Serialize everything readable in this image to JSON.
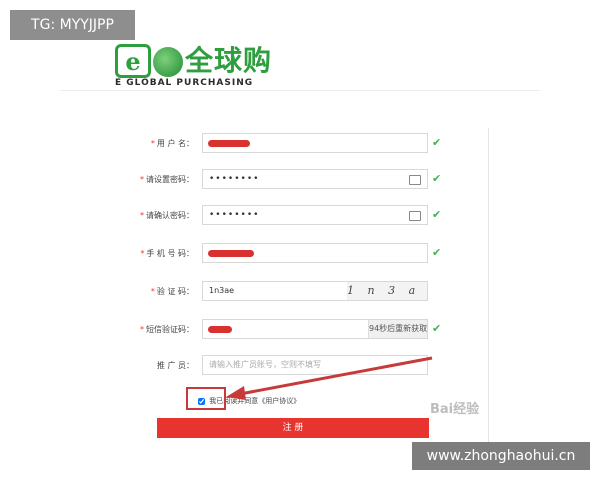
{
  "badge": {
    "text": "TG: MYYJJPP"
  },
  "logo": {
    "cn": "全球购",
    "en": "E GLOBAL PURCHASING",
    "e_letter": "e"
  },
  "form": {
    "username": {
      "label": "用 户 名："
    },
    "password": {
      "label": "请设置密码：",
      "value": "••••••••"
    },
    "confirm": {
      "label": "请确认密码：",
      "value": "••••••••"
    },
    "phone": {
      "label": "手 机 号 码："
    },
    "captcha": {
      "label": "验 证 码：",
      "value": "1n3ae",
      "image_text": "1 n 3 a e"
    },
    "sms": {
      "label": "短信验证码：",
      "button": "94秒后重新获取"
    },
    "promoter": {
      "label": "推 广 员：",
      "placeholder": "请输入推广员账号，空则不填写"
    },
    "agree_text": "我已阅读并同意《用户协议》",
    "register_label": "注 册",
    "check_mark": "✔",
    "required_mark": "*"
  },
  "overlay": {
    "watermark": "www.zhonghaohui.cn",
    "baidu": "Bai经验"
  },
  "colors": {
    "accent": "#e8342f",
    "logo_green": "#2e9e3e",
    "check": "#4caf50"
  }
}
